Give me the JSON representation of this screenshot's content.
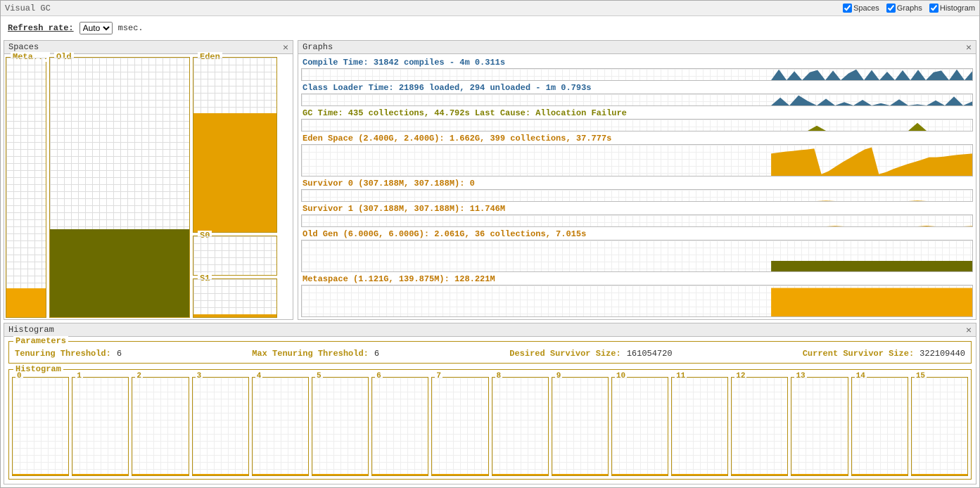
{
  "window": {
    "title": "Visual GC"
  },
  "checkboxes": {
    "spaces": "Spaces",
    "graphs": "Graphs",
    "histogram": "Histogram"
  },
  "refresh": {
    "label": "Refresh rate:",
    "value": "Auto",
    "unit": "msec."
  },
  "panels": {
    "spaces": "Spaces",
    "graphs": "Graphs",
    "histogram": "Histogram"
  },
  "spaces": {
    "meta": {
      "label": "Meta...",
      "fill_pct": 11,
      "fill_color": "#f0a500"
    },
    "old": {
      "label": "Old",
      "fill_pct": 34,
      "fill_color": "#6b6b00"
    },
    "eden": {
      "label": "Eden",
      "fill_pct": 68,
      "fill_color": "#e5a000"
    },
    "s0": {
      "label": "S0",
      "fill_pct": 0,
      "fill_color": "#e5a000"
    },
    "s1": {
      "label": "S1",
      "fill_pct": 8,
      "fill_color": "#e5a000"
    }
  },
  "graphs": {
    "compile": {
      "title": "Compile Time: 31842 compiles - 4m 0.311s",
      "color": "#2a6496",
      "fill": "#3b6e8f"
    },
    "loader": {
      "title": "Class Loader Time: 21896 loaded, 294 unloaded - 1m 0.793s",
      "color": "#2a6496",
      "fill": "#3b6e8f"
    },
    "gc": {
      "title": "GC Time: 435 collections, 44.792s  Last Cause: Allocation Failure",
      "color": "#808000",
      "fill": "#808000"
    },
    "eden": {
      "title": "Eden Space (2.400G, 2.400G): 1.662G, 399 collections, 37.777s",
      "color": "#c07800",
      "fill": "#e5a000"
    },
    "s0": {
      "title": "Survivor 0 (307.188M, 307.188M): 0",
      "color": "#c07800",
      "fill": "#e5a000"
    },
    "s1": {
      "title": "Survivor 1 (307.188M, 307.188M): 11.746M",
      "color": "#c07800",
      "fill": "#e5a000"
    },
    "old": {
      "title": "Old Gen (6.000G, 6.000G): 2.061G, 36 collections, 7.015s",
      "color": "#c07800",
      "fill": "#6b6b00"
    },
    "metaspace": {
      "title": "Metaspace (1.121G, 139.875M): 128.221M",
      "color": "#c07800",
      "fill": "#f0a500"
    }
  },
  "parameters": {
    "title": "Parameters",
    "tenuring_label": "Tenuring Threshold:",
    "tenuring_value": "6",
    "max_tenuring_label": "Max Tenuring Threshold:",
    "max_tenuring_value": "6",
    "desired_label": "Desired Survivor Size:",
    "desired_value": "161054720",
    "current_label": "Current Survivor Size:",
    "current_value": "322109440"
  },
  "histogram": {
    "title": "Histogram",
    "cells": [
      "0",
      "1",
      "2",
      "3",
      "4",
      "5",
      "6",
      "7",
      "8",
      "9",
      "10",
      "11",
      "12",
      "13",
      "14",
      "15"
    ]
  },
  "chart_data": [
    {
      "type": "area",
      "name": "Compile Time",
      "title": "Compile Time: 31842 compiles - 4m 0.311s",
      "x_fraction_range": [
        0.7,
        1.0
      ],
      "values_pct": [
        0,
        95,
        0,
        80,
        0,
        70,
        90,
        0,
        85,
        0,
        60,
        95,
        0,
        90,
        0,
        75,
        0,
        88,
        0,
        92,
        0,
        70,
        85,
        0,
        95,
        0,
        80
      ]
    },
    {
      "type": "area",
      "name": "Class Loader Time",
      "title": "Class Loader Time: 21896 loaded, 294 unloaded - 1m 0.793s",
      "x_fraction_range": [
        0.7,
        1.0
      ],
      "values_pct": [
        0,
        70,
        0,
        90,
        40,
        0,
        60,
        0,
        30,
        0,
        50,
        0,
        20,
        0,
        55,
        0,
        10,
        0,
        45,
        0,
        80,
        0,
        35
      ]
    },
    {
      "type": "area",
      "name": "GC Time",
      "title": "GC Time: 435 collections, 44.792s  Last Cause: Allocation Failure",
      "x_fraction_range": [
        0.7,
        1.0
      ],
      "values_pct": [
        0,
        0,
        0,
        0,
        0,
        45,
        0,
        0,
        0,
        0,
        0,
        0,
        0,
        0,
        0,
        0,
        70,
        0,
        0,
        0,
        0,
        0,
        0
      ]
    },
    {
      "type": "area",
      "name": "Eden Space",
      "title": "Eden Space (2.400G, 2.400G): 1.662G, 399 collections, 37.777s",
      "ylim": [
        0,
        2.4
      ],
      "unit": "G",
      "x_fraction_range": [
        0.7,
        1.0
      ],
      "values_pct": [
        72,
        75,
        78,
        80,
        83,
        85,
        88,
        5,
        15,
        30,
        45,
        58,
        72,
        85,
        92,
        5,
        12,
        22,
        30,
        38,
        45,
        52,
        60,
        60,
        62,
        65,
        68,
        70,
        72
      ]
    },
    {
      "type": "area",
      "name": "Survivor 0",
      "title": "Survivor 0 (307.188M, 307.188M): 0",
      "ylim": [
        0,
        307.188
      ],
      "unit": "M",
      "x_fraction_range": [
        0.7,
        1.0
      ],
      "values_pct": [
        0,
        0,
        0,
        0,
        0,
        0,
        4,
        0,
        0,
        0,
        0,
        0,
        0,
        0,
        0,
        0,
        5,
        0,
        0,
        0,
        0,
        0,
        0
      ]
    },
    {
      "type": "area",
      "name": "Survivor 1",
      "title": "Survivor 1 (307.188M, 307.188M): 11.746M",
      "ylim": [
        0,
        307.188
      ],
      "unit": "M",
      "x_fraction_range": [
        0.7,
        1.0
      ],
      "values_pct": [
        0,
        0,
        0,
        0,
        0,
        0,
        0,
        5,
        0,
        0,
        0,
        0,
        0,
        0,
        0,
        0,
        0,
        6,
        0,
        0,
        0,
        0,
        4
      ]
    },
    {
      "type": "area",
      "name": "Old Gen",
      "title": "Old Gen (6.000G, 6.000G): 2.061G, 36 collections, 7.015s",
      "ylim": [
        0,
        6.0
      ],
      "unit": "G",
      "x_fraction_range": [
        0.7,
        1.0
      ],
      "values_pct": [
        34,
        34,
        34,
        34,
        34,
        34,
        34,
        34,
        34,
        34,
        34,
        34,
        34,
        34,
        34,
        34,
        34,
        34,
        34,
        34,
        34,
        34,
        34
      ]
    },
    {
      "type": "area",
      "name": "Metaspace",
      "title": "Metaspace (1.121G, 139.875M): 128.221M",
      "ylim": [
        0,
        139.875
      ],
      "unit": "M",
      "x_fraction_range": [
        0.7,
        1.0
      ],
      "values_pct": [
        92,
        92,
        92,
        92,
        92,
        92,
        92,
        92,
        92,
        92,
        92,
        92,
        92,
        92,
        92,
        92,
        92,
        92,
        92,
        92,
        92,
        92,
        92
      ]
    }
  ]
}
